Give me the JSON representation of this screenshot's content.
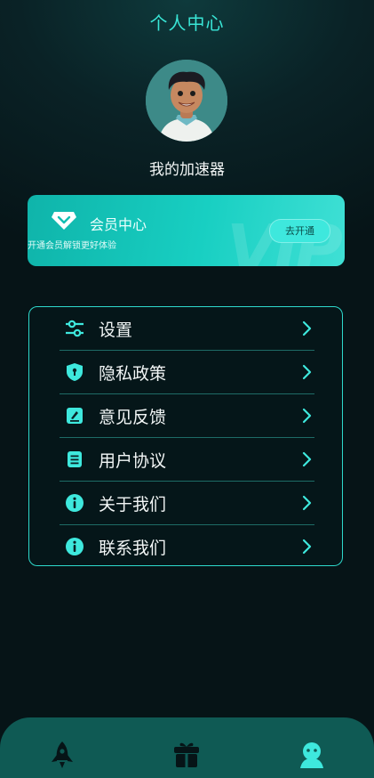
{
  "header": {
    "title": "个人中心"
  },
  "profile": {
    "username": "我的加速器",
    "avatar_icon": "avatar-illustration"
  },
  "vip": {
    "title": "会员中心",
    "subtitle": "开通会员解锁更好体验",
    "button_label": "去开通",
    "watermark": "VIP",
    "icon": "diamond-icon"
  },
  "menu": {
    "items": [
      {
        "label": "设置",
        "icon": "sliders-icon"
      },
      {
        "label": "隐私政策",
        "icon": "shield-icon"
      },
      {
        "label": "意见反馈",
        "icon": "edit-icon"
      },
      {
        "label": "用户协议",
        "icon": "document-icon"
      },
      {
        "label": "关于我们",
        "icon": "info-icon"
      },
      {
        "label": "联系我们",
        "icon": "info-icon"
      }
    ]
  },
  "tabbar": {
    "tabs": [
      {
        "icon": "rocket-icon",
        "active": false
      },
      {
        "icon": "gift-icon",
        "active": false
      },
      {
        "icon": "user-icon",
        "active": true
      }
    ]
  },
  "colors": {
    "accent": "#39e6d6",
    "background": "#061417",
    "tabbar": "#0f5a54",
    "vip_gradient_start": "#0fb4aa",
    "vip_gradient_end": "#3fe0d5"
  }
}
